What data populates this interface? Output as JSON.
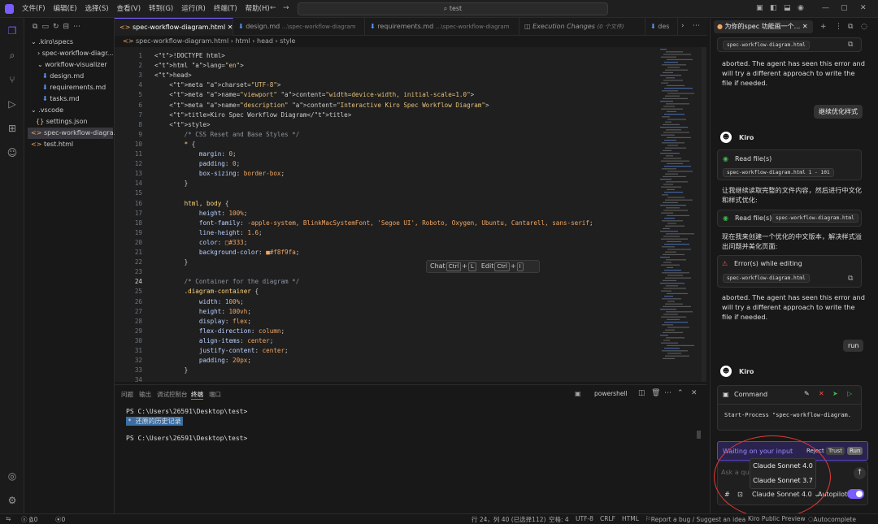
{
  "menu": [
    "文件(F)",
    "编辑(E)",
    "选择(S)",
    "查看(V)",
    "转到(G)",
    "运行(R)",
    "终端(T)",
    "帮助(H)"
  ],
  "search": "test",
  "explorer": {
    "items": [
      ".kiro\\specs",
      "spec-workflow-diagr...",
      "workflow-visualizer",
      "design.md",
      "requirements.md",
      "tasks.md",
      ".vscode",
      "settings.json",
      "spec-workflow-diagra...",
      "test.html"
    ]
  },
  "tabs": [
    "spec-workflow-diagram.html",
    "design.md",
    "requirements.md",
    "Execution Changes",
    "des"
  ],
  "tab_hints": {
    "design": "...\\spec-workflow-diagram",
    "requirements": "...\\spec-workflow-diagram",
    "exec": "(0 个文件)"
  },
  "breadcrumb": {
    "file": "spec-workflow-diagram.html",
    "html": "html",
    "head": "head",
    "style": "style"
  },
  "code": [
    {
      "n": "1",
      "t": "<!DOCTYPE html>"
    },
    {
      "n": "2",
      "t": "<html lang=\"en\">"
    },
    {
      "n": "3",
      "t": "<head>"
    },
    {
      "n": "4",
      "t": "    <meta charset=\"UTF-8\">"
    },
    {
      "n": "5",
      "t": "    <meta name=\"viewport\" content=\"width=device-width, initial-scale=1.0\">"
    },
    {
      "n": "6",
      "t": "    <meta name=\"description\" content=\"Interactive Kiro Spec Workflow Diagram\">"
    },
    {
      "n": "7",
      "t": "    <title>Kiro Spec Workflow Diagram</title>"
    },
    {
      "n": "8",
      "t": "    <style>"
    },
    {
      "n": "9",
      "t": "        /* CSS Reset and Base Styles */"
    },
    {
      "n": "10",
      "t": "        * {"
    },
    {
      "n": "11",
      "t": "            margin: 0;"
    },
    {
      "n": "12",
      "t": "            padding: 0;"
    },
    {
      "n": "13",
      "t": "            box-sizing: border-box;"
    },
    {
      "n": "14",
      "t": "        }"
    },
    {
      "n": "15",
      "t": ""
    },
    {
      "n": "16",
      "t": "        html, body {"
    },
    {
      "n": "17",
      "t": "            height: 100%;"
    },
    {
      "n": "18",
      "t": "            font-family: -apple-system, BlinkMacSystemFont, 'Segoe UI', Roboto, Oxygen, Ubuntu, Cantarell, sans-serif;"
    },
    {
      "n": "19",
      "t": "            line-height: 1.6;"
    },
    {
      "n": "20",
      "t": "            color: □#333;"
    },
    {
      "n": "21",
      "t": "            background-color: ■#f8f9fa;"
    },
    {
      "n": "22",
      "t": "        }"
    },
    {
      "n": "23",
      "t": ""
    },
    {
      "n": "24",
      "t": "        /* Container for the diagram */"
    },
    {
      "n": "25",
      "t": "        .diagram-container {"
    },
    {
      "n": "26",
      "t": "            width: 100%;"
    },
    {
      "n": "27",
      "t": "            height: 100vh;"
    },
    {
      "n": "28",
      "t": "            display: flex;"
    },
    {
      "n": "29",
      "t": "            flex-direction: column;"
    },
    {
      "n": "30",
      "t": "            align-items: center;"
    },
    {
      "n": "31",
      "t": "            justify-content: center;"
    },
    {
      "n": "32",
      "t": "            padding: 20px;"
    },
    {
      "n": "33",
      "t": "        }"
    },
    {
      "n": "34",
      "t": ""
    }
  ],
  "hint": {
    "chat": "Chat",
    "chat_key1": "Ctrl",
    "chat_key2": "L",
    "edit": "Edit",
    "edit_key1": "Ctrl",
    "edit_key2": "I"
  },
  "panel": {
    "tabs": [
      "问题",
      "输出",
      "调试控制台",
      "终端",
      "端口"
    ],
    "shell": "powershell",
    "lines": [
      "PS C:\\Users\\26591\\Desktop\\test>",
      "PS C:\\Users\\26591\\Desktop\\test>"
    ],
    "restored": "* 还原的历史记录"
  },
  "chat": {
    "title": "为你的spec 功能画一个...",
    "file_chip_top": "spec-workflow-diagram.html",
    "abort1": "aborted. The agent has seen this error and will try a different approach to write the file if needed.",
    "user1": "继续优化样式",
    "agent": "Kiro",
    "readfile1": "Read file(s)",
    "readfile1_chip": "spec-workflow-diagram.html 1 - 101",
    "msg1": "让我继续读取完整的文件内容，然后进行中文化和样式优化:",
    "readfile2": "Read file(s)",
    "readfile2_chip": "spec-workflow-diagram.html",
    "msg2": "现在我来创建一个优化的中文版本，解决样式溢出问题并美化页面:",
    "error": "Error(s) while editing",
    "error_chip": "spec-workflow-diagram.html",
    "abort2": "aborted. The agent has seen this error and will try a different approach to write the file if needed.",
    "user2": "run",
    "agent2": "Kiro",
    "command_label": "Command",
    "command_text": "Start-Process \"spec-workflow-diagram.",
    "waiting": "Waiting on your input",
    "reject": "Reject",
    "trust": "Trust",
    "run": "Run",
    "input_placeholder": "Ask a question...",
    "models": [
      "Claude Sonnet 4.0",
      "Claude Sonnet 3.7"
    ],
    "selected_model": "Claude Sonnet 4.0",
    "autopilot": "Autopilot"
  },
  "status": {
    "errors": "0",
    "warnings": "0",
    "ports": "0",
    "position": "行 24，列 40 (已选择112)",
    "spaces": "空格: 4",
    "encoding": "UTF-8",
    "eol": "CRLF",
    "lang": "HTML",
    "report": "Report a bug / Suggest an idea",
    "preview": "Kiro Public Preview",
    "autocomplete": "Autocomplete"
  },
  "colors": {
    "accent": "#7a5cff",
    "annotation": "#e53935"
  }
}
